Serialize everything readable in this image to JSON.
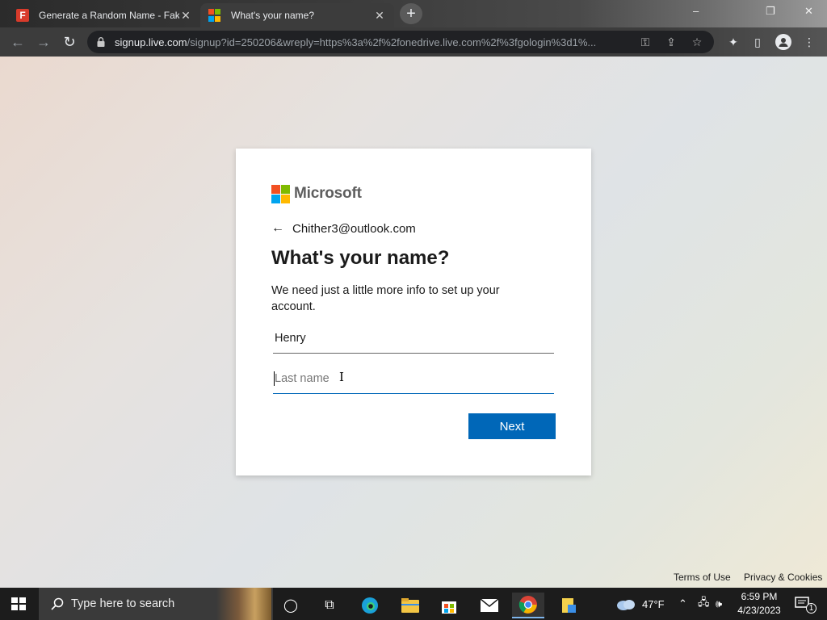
{
  "browser": {
    "tabs": [
      {
        "title": "Generate a Random Name - Fak",
        "favicon": "fakenamegenerator-icon",
        "active": false
      },
      {
        "title": "What's your name?",
        "favicon": "microsoft-icon",
        "active": true
      }
    ],
    "new_tab_symbol": "+",
    "url_host": "signup.live.com",
    "url_rest": "/signup?id=250206&wreply=https%3a%2f%2fonedrive.live.com%2f%3fgologin%3d1%..."
  },
  "signin": {
    "brand": "Microsoft",
    "identity": "Chither3@outlook.com",
    "heading": "What's your name?",
    "description": "We need just a little more info to set up your account.",
    "first_name_value": "Henry",
    "last_name_placeholder": "Last name",
    "next_label": "Next"
  },
  "footer": {
    "terms": "Terms of Use",
    "privacy": "Privacy & Cookies"
  },
  "taskbar": {
    "search_placeholder": "Type here to search",
    "weather": "47°F",
    "time": "6:59 PM",
    "date": "4/23/2023",
    "notification_count": "1"
  },
  "colors": {
    "accent": "#0067b8",
    "ms_red": "#f25022",
    "ms_green": "#7fba00",
    "ms_blue": "#00a4ef",
    "ms_yellow": "#ffb900"
  }
}
